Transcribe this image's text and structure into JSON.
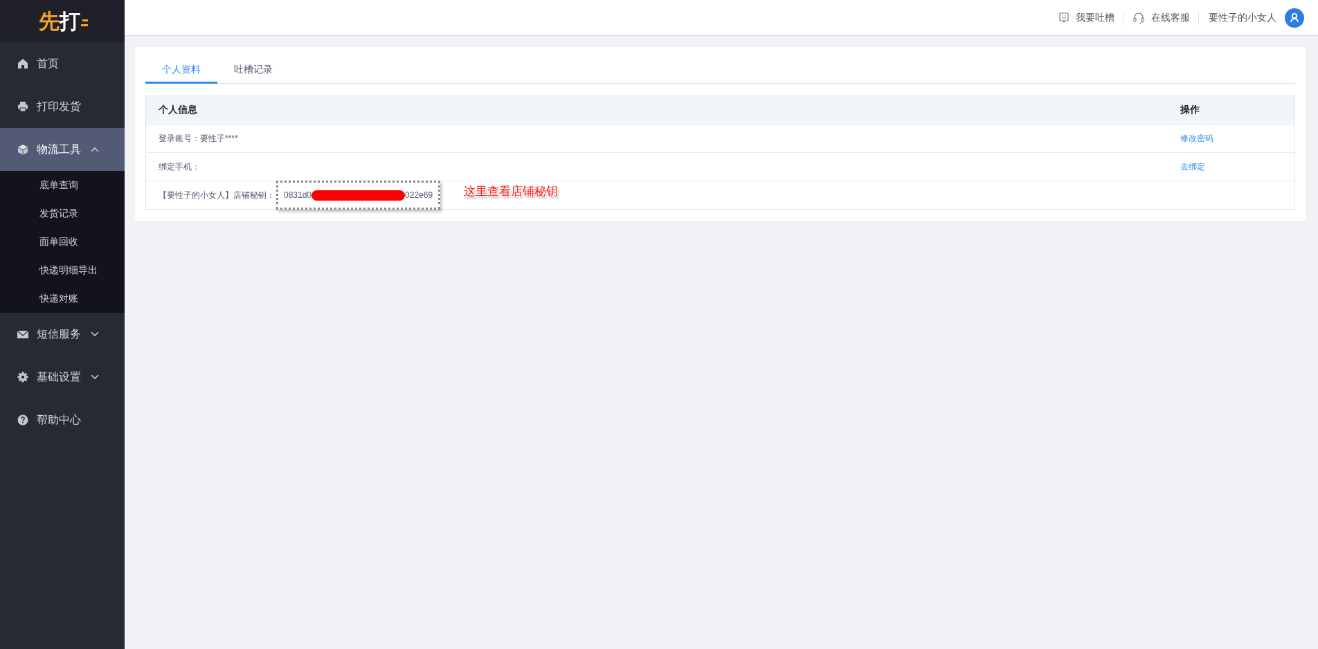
{
  "logo": {
    "parts": [
      {
        "text": "先",
        "color": "#f5a623"
      },
      {
        "text": "打",
        "color": "#ffffff"
      }
    ]
  },
  "sidebar": {
    "items": [
      {
        "label": "首页",
        "selected": false
      },
      {
        "label": "打印发货",
        "selected": false
      },
      {
        "label": "物流工具",
        "selected": true,
        "expanded": true,
        "children": [
          {
            "label": "底单查询",
            "selected": false
          },
          {
            "label": "发货记录",
            "selected": false
          },
          {
            "label": "面单回收",
            "selected": false
          },
          {
            "label": "快递明细导出",
            "selected": false
          },
          {
            "label": "快递对账",
            "selected": false
          }
        ]
      },
      {
        "label": "短信服务",
        "selected": false,
        "expanded": false
      },
      {
        "label": "基础设置",
        "selected": false,
        "expanded": false
      },
      {
        "label": "帮助中心",
        "selected": false
      }
    ]
  },
  "top_bar": {
    "feedback": "我要吐槽",
    "service": "在线客服",
    "user": "要性子的小女人"
  },
  "tabs": [
    {
      "label": "个人资料",
      "selected": true
    },
    {
      "label": "吐槽记录",
      "selected": false
    }
  ],
  "table": {
    "columns": [
      "个人信息",
      "操作"
    ],
    "rows": [
      {
        "kind": "text",
        "label": "登录账号：要性子****",
        "action": "修改密码"
      },
      {
        "kind": "text",
        "label": "绑定手机：",
        "action": "去绑定"
      },
      {
        "kind": "key",
        "label": "【要性子的小女人】店铺秘钥：",
        "key_start": "0831d0",
        "key_end": "022e69",
        "redacted": true,
        "annotation": "这里查看店铺秘钥"
      }
    ]
  }
}
